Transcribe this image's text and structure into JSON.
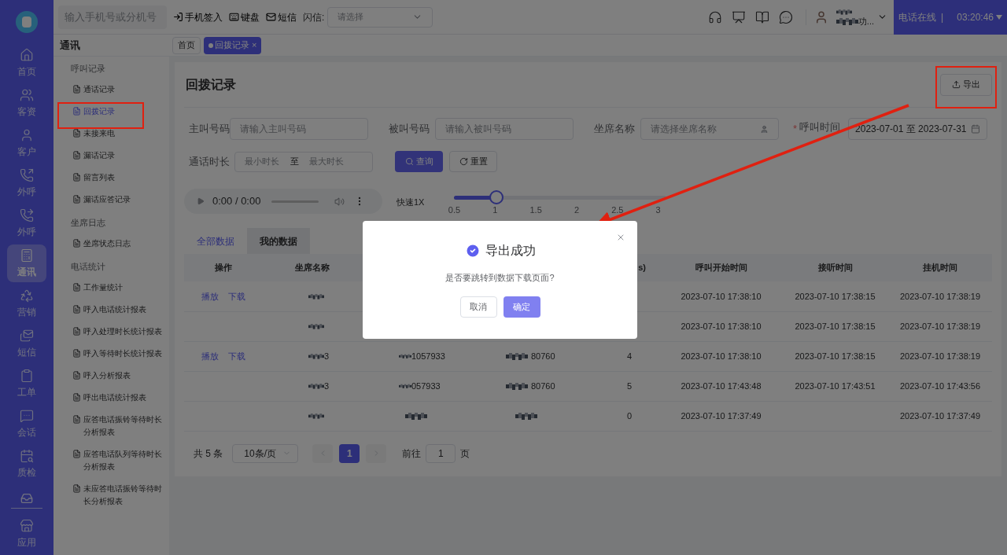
{
  "topbar": {
    "search_placeholder": "输入手机号或分机号",
    "actions": [
      {
        "kind": "signin",
        "label": "手机签入"
      },
      {
        "kind": "keyboard",
        "label": "键盘"
      },
      {
        "kind": "sms",
        "label": "短信"
      }
    ],
    "flash_label": "闪信:",
    "flash_placeholder": "请选择",
    "user_name_tail": "功...",
    "status": "电话在线",
    "separator": "|",
    "timer": "03:20:46"
  },
  "nav": [
    {
      "kind": "home",
      "label": "首页",
      "selected": false
    },
    {
      "kind": "users",
      "label": "客资",
      "selected": false
    },
    {
      "kind": "user",
      "label": "客户",
      "selected": false
    },
    {
      "kind": "call-out",
      "label": "外呼",
      "selected": false
    },
    {
      "kind": "call-forward",
      "label": "外呼",
      "selected": false
    },
    {
      "kind": "phone-book",
      "label": "通讯",
      "selected": true
    },
    {
      "kind": "recycle",
      "label": "营销",
      "selected": false
    },
    {
      "kind": "mail",
      "label": "短信",
      "selected": false
    },
    {
      "kind": "clipboard",
      "label": "工单",
      "selected": false
    },
    {
      "kind": "chat",
      "label": "会话",
      "selected": false
    },
    {
      "kind": "calendar",
      "label": "质检",
      "selected": false
    },
    {
      "kind": "tray"
    },
    {
      "kind": "store",
      "label": "应用",
      "selected": false
    }
  ],
  "submenu": {
    "title": "通讯",
    "groups": [
      {
        "title": "呼叫记录",
        "items": [
          {
            "label": "通话记录",
            "selected": false
          },
          {
            "label": "回拨记录",
            "selected": true
          },
          {
            "label": "未接来电",
            "selected": false
          },
          {
            "label": "漏话记录",
            "selected": false
          },
          {
            "label": "留言列表",
            "selected": false
          },
          {
            "label": "漏话应答记录",
            "selected": false
          }
        ]
      },
      {
        "title": "坐席日志",
        "items": [
          {
            "label": "坐席状态日志",
            "selected": false
          }
        ]
      },
      {
        "title": "电话统计",
        "items": [
          {
            "label": "工作量统计",
            "selected": false
          },
          {
            "label": "呼入电话统计报表",
            "selected": false
          },
          {
            "label": "呼入处理时长统计报表",
            "selected": false
          },
          {
            "label": "呼入等待时长统计报表",
            "selected": false
          },
          {
            "label": "呼入分析报表",
            "selected": false
          },
          {
            "label": "呼出电话统计报表",
            "selected": false
          },
          {
            "label": "应答电话振铃等待时长分析报表",
            "selected": false
          },
          {
            "label": "应答电话队列等待时长分析报表",
            "selected": false
          },
          {
            "label": "未应答电话振铃等待时长分析报表",
            "selected": false
          }
        ]
      }
    ]
  },
  "page_tabs": [
    {
      "label": "首页",
      "selected": false
    },
    {
      "label": "回拨记录",
      "selected": true,
      "close": "×"
    }
  ],
  "page": {
    "title": "回拨记录",
    "export_label": "导出"
  },
  "filters": {
    "caller_label": "主叫号码",
    "caller_placeholder": "请输入主叫号码",
    "callee_label": "被叫号码",
    "callee_placeholder": "请输入被叫号码",
    "agent_label": "坐席名称",
    "agent_placeholder": "请选择坐席名称",
    "time_required": "*",
    "time_label": "呼叫时间",
    "time_value": "2023-07-01 至 2023-07-31",
    "duration_label": "通话时长",
    "duration_min": "最小时长",
    "duration_sep": "至",
    "duration_max": "最大时长",
    "query": "查询",
    "reset": "重置"
  },
  "player": {
    "time": "0:00 / 0:00",
    "speed_label": "快速1X",
    "speed": {
      "level": 0.2,
      "ticks": [
        "0.5",
        "1",
        "1.5",
        "2",
        "2.5",
        "3"
      ]
    }
  },
  "data_tabs": [
    {
      "label": "全部数据",
      "selected": true
    },
    {
      "label": "我的数据",
      "selected": false
    }
  ],
  "table": {
    "columns": [
      "操作",
      "坐席名称",
      "",
      "",
      "s)",
      "呼叫开始时间",
      "接听时间",
      "挂机时间"
    ],
    "rows": [
      {
        "actions": [
          "播放",
          "下载"
        ],
        "start": "2023-07-10 17:38:10",
        "answer": "2023-07-10 17:38:15",
        "hangup": "2023-07-10 17:38:19"
      },
      {
        "start": "2023-07-10 17:38:10",
        "answer": "2023-07-10 17:38:15",
        "hangup": "2023-07-10 17:38:19"
      },
      {
        "actions": [
          "播放",
          "下载"
        ],
        "agent": "3",
        "caller": "1057933",
        "callee": "80760",
        "duration": "4",
        "start": "2023-07-10 17:38:10",
        "answer": "2023-07-10 17:38:15",
        "hangup": "2023-07-10 17:38:19"
      },
      {
        "agent": "3",
        "caller": "057933",
        "callee": "80760",
        "duration": "5",
        "start": "2023-07-10 17:43:48",
        "answer": "2023-07-10 17:43:51",
        "hangup": "2023-07-10 17:43:56"
      },
      {
        "duration": "0",
        "start": "2023-07-10 17:37:49",
        "hangup": "2023-07-10 17:37:49"
      }
    ]
  },
  "pagination": {
    "total": "共 5 条",
    "page_size": "10条/页",
    "pages": [
      {
        "label": "1",
        "selected": true
      }
    ],
    "goto_label": "前往",
    "goto_value": "1",
    "goto_unit": "页"
  },
  "dialog": {
    "title": "导出成功",
    "message": "是否要跳转到数据下载页面?",
    "cancel": "取消",
    "confirm": "确定"
  }
}
